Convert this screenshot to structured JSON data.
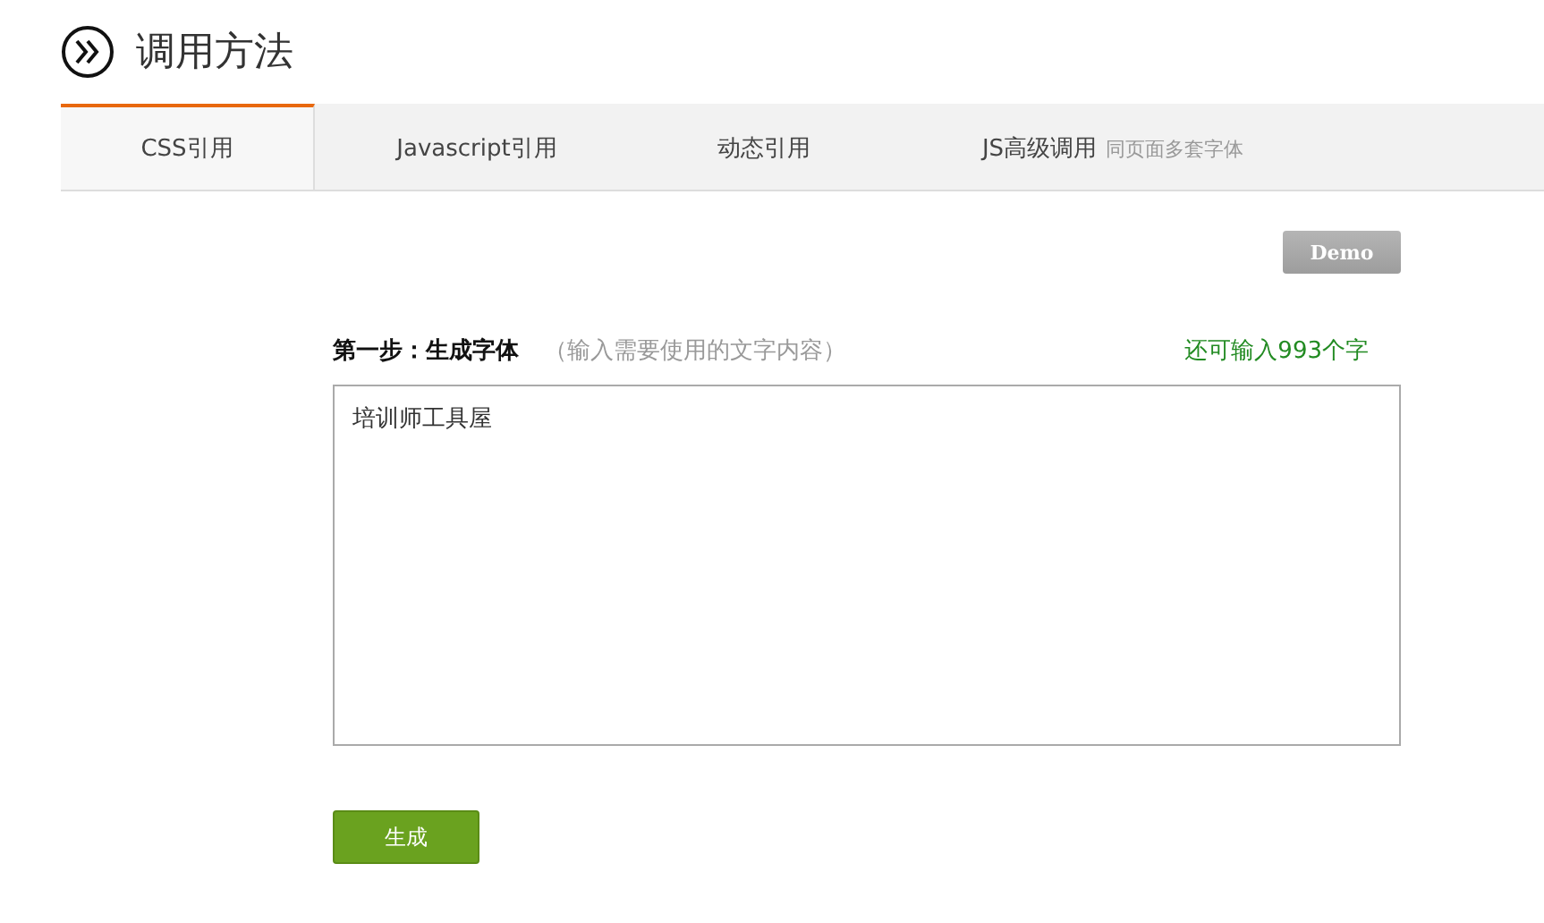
{
  "header": {
    "title": "调用方法"
  },
  "tabs": [
    {
      "label": "CSS引用",
      "selected": true
    },
    {
      "label": "Javascript引用",
      "selected": false
    },
    {
      "label": "动态引用",
      "selected": false
    },
    {
      "label": "JS高级调用",
      "note": "同页面多套字体",
      "selected": false
    }
  ],
  "demo_button": {
    "label": "Demo",
    "disabled": true
  },
  "step": {
    "title": "第一步：生成字体",
    "hint": "（输入需要使用的文字内容）",
    "remaining": "还可输入993个字"
  },
  "text_input": {
    "value": "培训师工具屋"
  },
  "generate_button": {
    "label": "生成"
  }
}
